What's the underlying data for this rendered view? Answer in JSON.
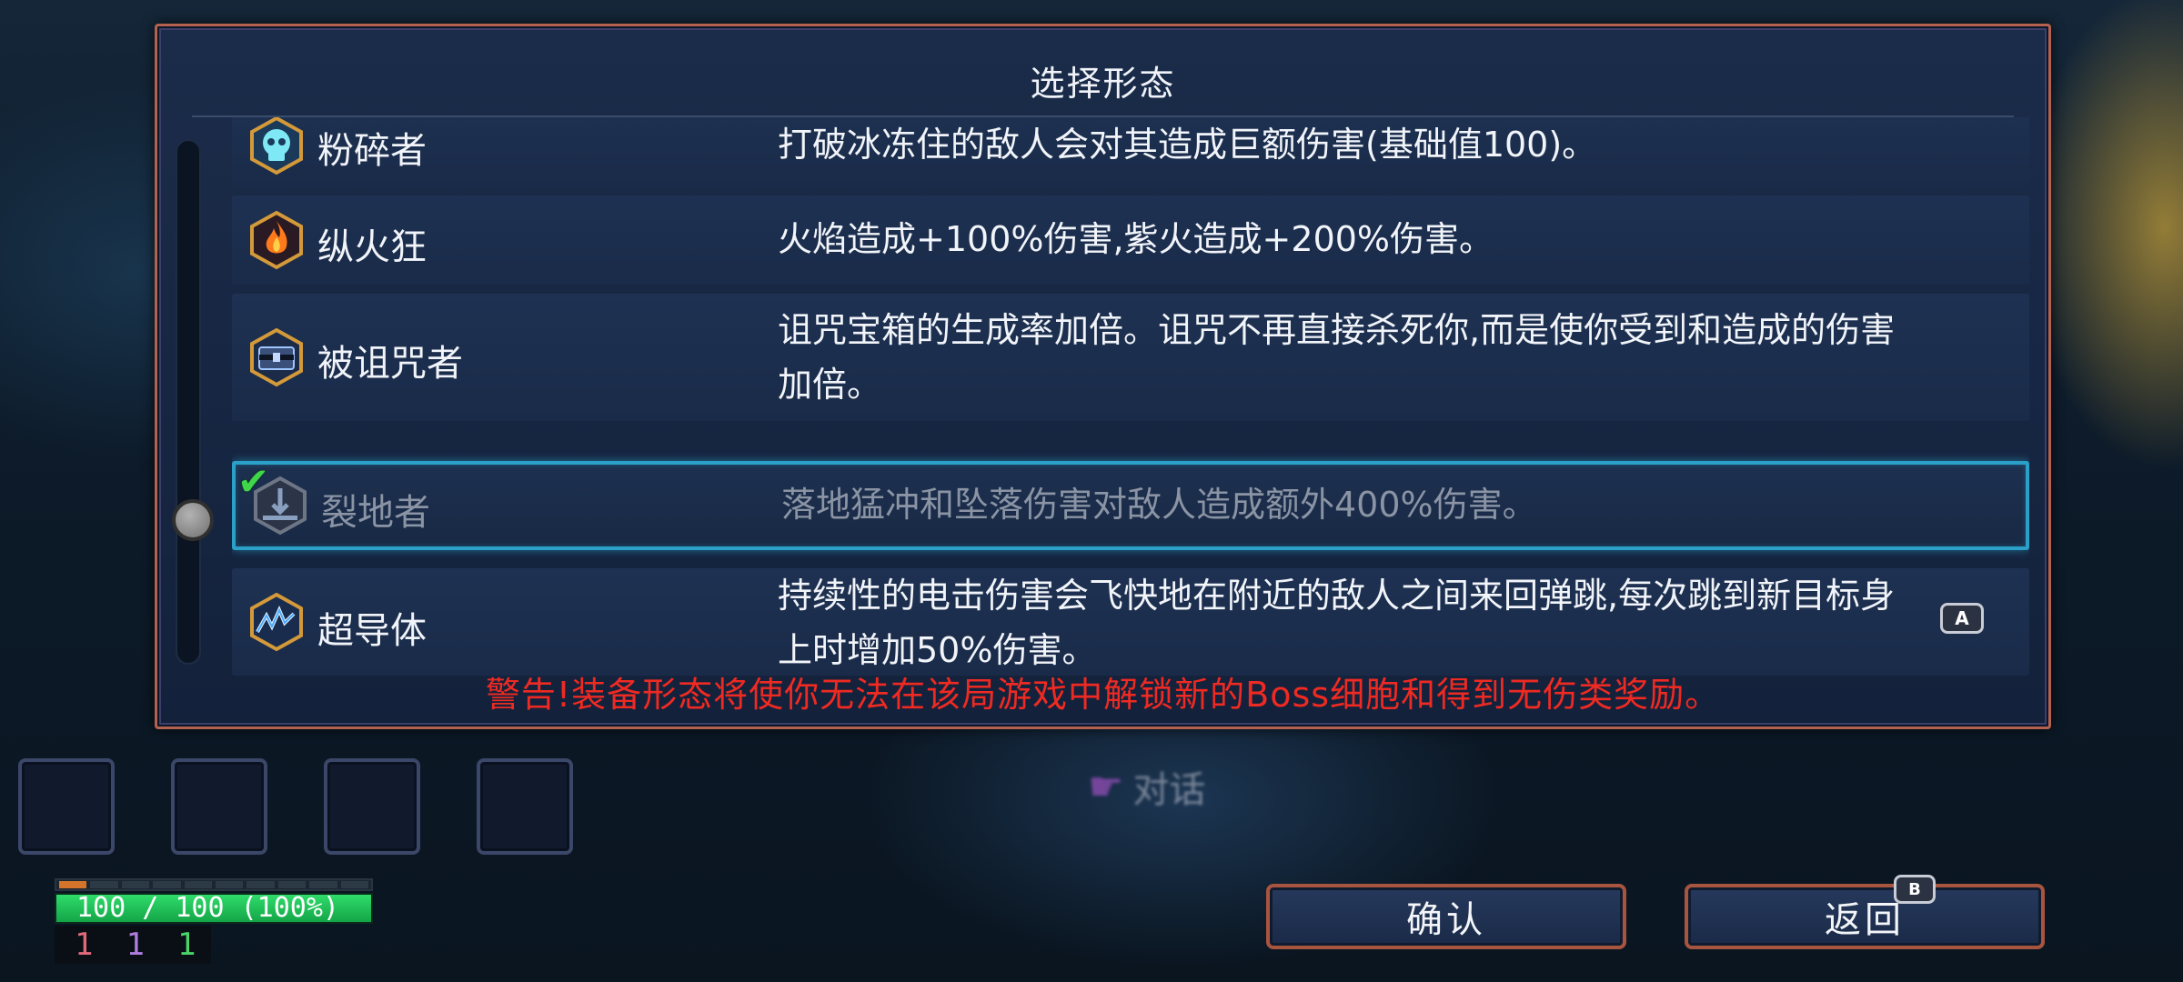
{
  "dialog": {
    "title": "选择形态",
    "warning": "警告!装备形态将使你无法在该局游戏中解锁新的Boss细胞和得到无伤类奖励。",
    "scroll_position": 0.55
  },
  "forms": [
    {
      "name": "粉碎者",
      "icon": "skull-ice-icon",
      "description": "打破冰冻住的敌人会对其造成巨额伤害(基础值100)。",
      "selected": false
    },
    {
      "name": "纵火狂",
      "icon": "flame-icon",
      "description": "火焰造成+100%伤害,紫火造成+200%伤害。",
      "selected": false
    },
    {
      "name": "被诅咒者",
      "icon": "cursed-chest-icon",
      "description": "诅咒宝箱的生成率加倍。诅咒不再直接杀死你,而是使你受到和造成的伤害加倍。",
      "selected": false
    },
    {
      "name": "裂地者",
      "icon": "ground-slam-icon",
      "description": "落地猛冲和坠落伤害对敌人造成额外400%伤害。",
      "selected": true
    },
    {
      "name": "超导体",
      "icon": "lightning-icon",
      "description": "持续性的电击伤害会飞快地在附近的敌人之间来回弹跳,每次跳到新目标身上时增加50%伤害。",
      "selected": false
    }
  ],
  "key_hints": {
    "select": "A",
    "back": "B"
  },
  "background": {
    "talk_label": "对话",
    "talk_icon": "talk-hand-icon"
  },
  "hud": {
    "health_text": "100 / 100 (100%)",
    "health_fraction": 1.0,
    "stats": [
      {
        "value": "1",
        "color": "#e06a7a"
      },
      {
        "value": "1",
        "color": "#b07de0"
      },
      {
        "value": "1",
        "color": "#4ad36a"
      }
    ],
    "empty_slots": 4
  },
  "buttons": {
    "confirm": "确认",
    "back": "返回"
  },
  "colors": {
    "warning": "#ee2a22",
    "selection_border": "#2aa0c9",
    "panel_border": "#b4614f",
    "health": "#2fdc6a"
  }
}
